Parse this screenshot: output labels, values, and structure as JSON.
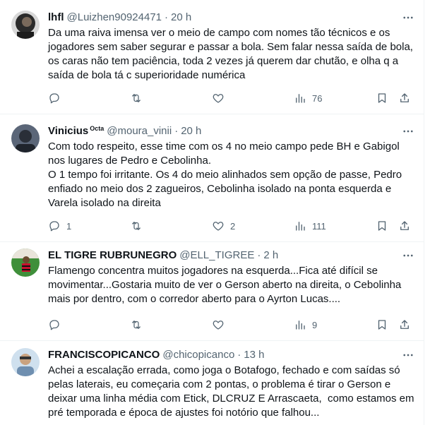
{
  "tweets": [
    {
      "name": "lhfl",
      "badge": "",
      "handle": "@Luizhen90924471",
      "dot": "·",
      "time": "20 h",
      "text": "Da uma raiva imensa ver o meio de campo com nomes tão técnicos e os jogadores sem saber segurar e passar a bola. Sem falar nessa saída de bola, os caras não tem paciência, toda 2 vezes já querem dar chutão, e olha q a saída de bola tá c superioridade numérica",
      "replies": "",
      "retweets": "",
      "likes": "",
      "views": "76",
      "avatar_color": "#2b2b2b"
    },
    {
      "name": "Vinicius",
      "badge": "Octa",
      "handle": "@moura_vinii",
      "dot": "·",
      "time": "20 h",
      "text": "Com todo respeito, esse time com os 4 no meio campo pede BH e Gabigol nos lugares de Pedro e Cebolinha.\nO 1 tempo foi irritante. Os 4 do meio alinhados sem opção de passe, Pedro enfiado no meio dos 2 zagueiros, Cebolinha isolado na ponta esquerda e Varela isolado na direita",
      "replies": "1",
      "retweets": "",
      "likes": "2",
      "views": "111",
      "avatar_color": "#3a4556"
    },
    {
      "name": "EL TIGRE RUBRUNEGRO",
      "badge": "",
      "handle": "@ELL_TIGREE",
      "dot": "·",
      "time": "2 h",
      "text": "Flamengo concentra muitos jogadores na esquerda...Fica até difícil se movimentar...Gostaria muito de ver o Gerson aberto na direita, o Cebolinha mais por dentro, com o corredor aberto para o Ayrton Lucas....",
      "replies": "",
      "retweets": "",
      "likes": "",
      "views": "9",
      "avatar_color": "#c8102e"
    },
    {
      "name": "FRANCISCOPICANCO",
      "badge": "",
      "handle": "@chicopicanco",
      "dot": "·",
      "time": "13 h",
      "text": "Achei a escalação errada, como joga o Botafogo, fechado e com saídas só pelas laterais, eu começaria com 2 pontas, o problema é tirar o Gerson e deixar uma linha média com Etick, DLCRUZ E Arrascaeta,  como estamos em pré temporada e época de ajustes foi notório que falhou...",
      "replies": "",
      "retweets": "",
      "likes": "",
      "views": "",
      "avatar_color": "#9fb8cf"
    }
  ],
  "icons": {
    "reply": "reply-icon",
    "retweet": "retweet-icon",
    "like": "heart-icon",
    "views": "views-icon",
    "bookmark": "bookmark-icon",
    "share": "share-icon",
    "more": "more-icon"
  },
  "colors": {
    "text": "#0f1419",
    "secondary": "#536471",
    "border": "#eff3f4"
  }
}
